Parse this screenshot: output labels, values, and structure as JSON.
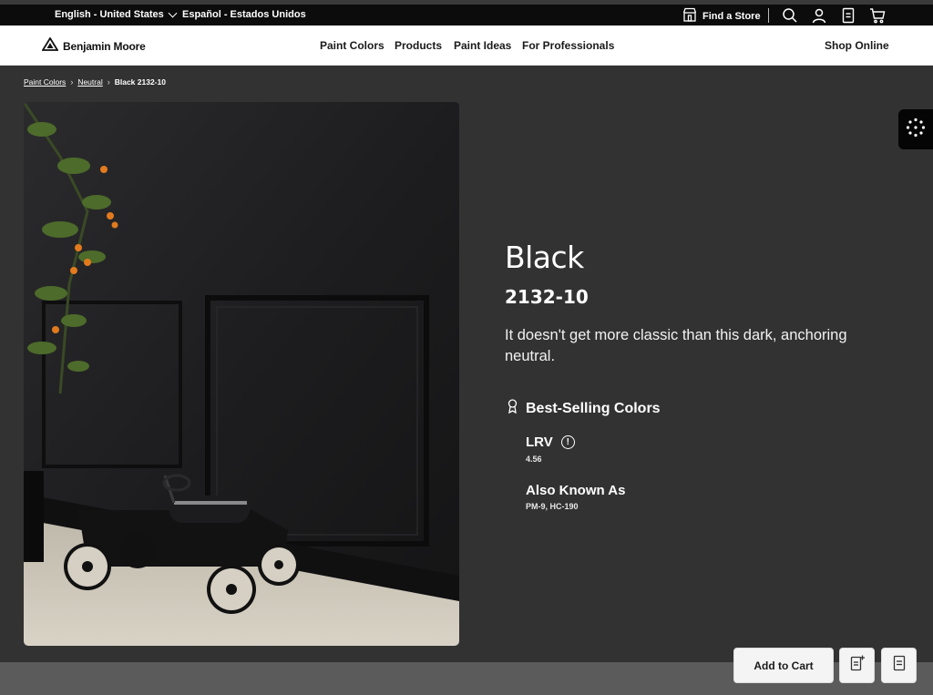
{
  "utility_bar": {
    "language_en": "English - United States",
    "language_es": "Español - Estados Unidos",
    "find_store": "Find a Store"
  },
  "nav": {
    "logo": "Benjamin Moore",
    "links": [
      "Paint Colors",
      "Products",
      "Paint Ideas",
      "For Professionals"
    ],
    "shop_online": "Shop Online"
  },
  "breadcrumb": {
    "items": [
      "Paint Colors",
      "Neutral"
    ],
    "current": "Black 2132-10"
  },
  "color": {
    "name": "Black",
    "code": "2132-10",
    "description": "It doesn't get more classic than this dark, anchoring neutral.",
    "feature": "Best-Selling Colors",
    "lrv_label": "LRV",
    "lrv_value": "4.56",
    "aka_label": "Also Known As",
    "aka_value": "PM-9, HC-190"
  },
  "actions": {
    "add_to_cart": "Add to Cart"
  },
  "icons": [
    "chevron-down-icon",
    "store-icon",
    "search-icon",
    "user-icon",
    "list-icon",
    "cart-icon",
    "logo-mark-icon",
    "chevron-right-icon",
    "dots-tool-icon",
    "award-ribbon-icon",
    "info-icon",
    "add-to-list-icon",
    "document-icon"
  ],
  "colors": {
    "page_bg": "#323232",
    "utility_bar": "#0c0c0c",
    "nav_bg": "#ffffff",
    "button_bg": "#f4f4f4"
  }
}
